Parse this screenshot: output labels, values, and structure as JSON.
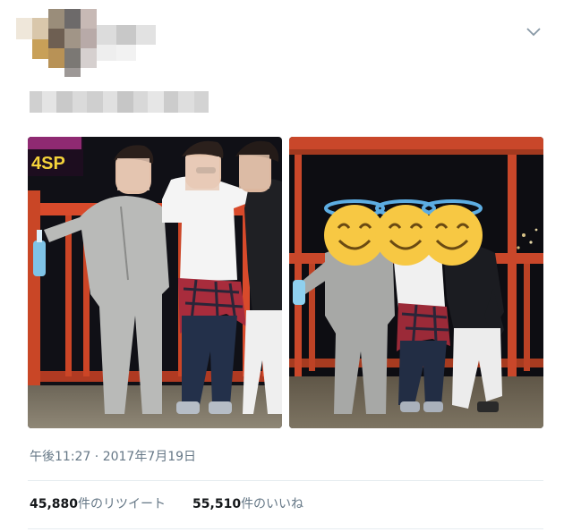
{
  "tweet": {
    "timestamp": "午後11:27 · 2017年7月19日",
    "retweets": {
      "count": "45,880",
      "label": "件のリツイート"
    },
    "likes": {
      "count": "55,510",
      "label": "件のいいね"
    }
  },
  "icons": {
    "caret": "chevron-down-icon",
    "halo_faces": "smiling-face-with-halo-icon"
  },
  "colors": {
    "railing": "#d84a2b",
    "sky": "#111118",
    "caret": "#8899a6",
    "emoji": "#f7c843",
    "halo": "#5dade2"
  }
}
